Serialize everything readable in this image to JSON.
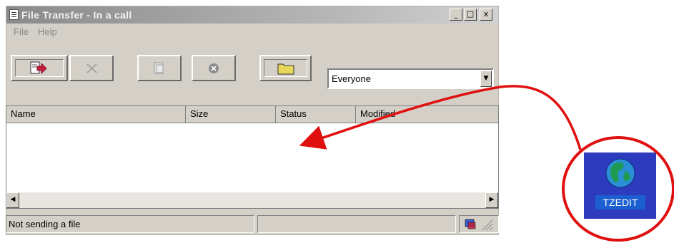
{
  "window": {
    "title": "File Transfer - In a call",
    "controls": {
      "minimize": "_",
      "maximize": "□",
      "close": "x"
    }
  },
  "menu": [
    "File",
    "Help"
  ],
  "toolbar": {
    "buttons": [
      {
        "icon": "send-file-icon"
      },
      {
        "icon": "remove-icon"
      },
      {
        "icon": "copy-icon"
      },
      {
        "icon": "cancel-icon"
      },
      {
        "icon": "folder-icon"
      }
    ],
    "recipient": "Everyone"
  },
  "file_list": {
    "columns": [
      "Name",
      "Size",
      "Status",
      "Modified"
    ],
    "rows": []
  },
  "statusbar": {
    "text": "Not sending a file"
  },
  "desktop_icon": {
    "label": "TZEDIT"
  },
  "colors": {
    "annotation": "#e01010",
    "icon_bg": "#2d3bbf",
    "globe": "#1f9a52"
  }
}
